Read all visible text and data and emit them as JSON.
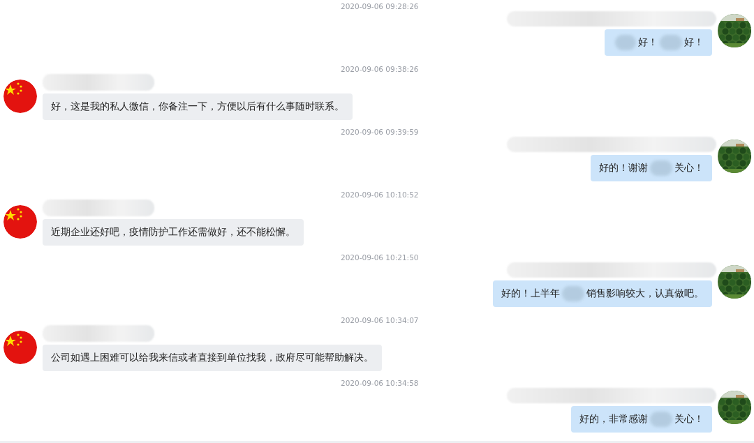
{
  "messages": [
    {
      "time": "2020-09-06 09:28:26",
      "kind": "outgoing",
      "leading_blur": true,
      "parts": [
        "好！",
        "好！"
      ]
    },
    {
      "time": "2020-09-06 09:38:26",
      "kind": "incoming",
      "leading_blur": false,
      "parts": [
        "好，这是我的私人微信，你备注一下，方便以后有什么事随时联系。"
      ]
    },
    {
      "time": "2020-09-06 09:39:59",
      "kind": "outgoing",
      "leading_blur": false,
      "parts": [
        "好的！谢谢",
        "关心！"
      ]
    },
    {
      "time": "2020-09-06 10:10:52",
      "kind": "incoming",
      "leading_blur": false,
      "parts": [
        "近期企业还好吧，疫情防护工作还需做好，还不能松懈。"
      ]
    },
    {
      "time": "2020-09-06 10:21:50",
      "kind": "outgoing",
      "leading_blur": false,
      "parts": [
        "好的！上半年",
        "销售影响较大，认真做吧。"
      ]
    },
    {
      "time": "2020-09-06 10:34:07",
      "kind": "incoming",
      "leading_blur": false,
      "parts": [
        "公司如遇上困难可以给我来信或者直接到单位找我，政府尽可能帮助解决。"
      ]
    },
    {
      "time": "2020-09-06 10:34:58",
      "kind": "outgoing",
      "leading_blur": false,
      "parts": [
        "好的，非常感谢",
        "关心！"
      ]
    }
  ]
}
